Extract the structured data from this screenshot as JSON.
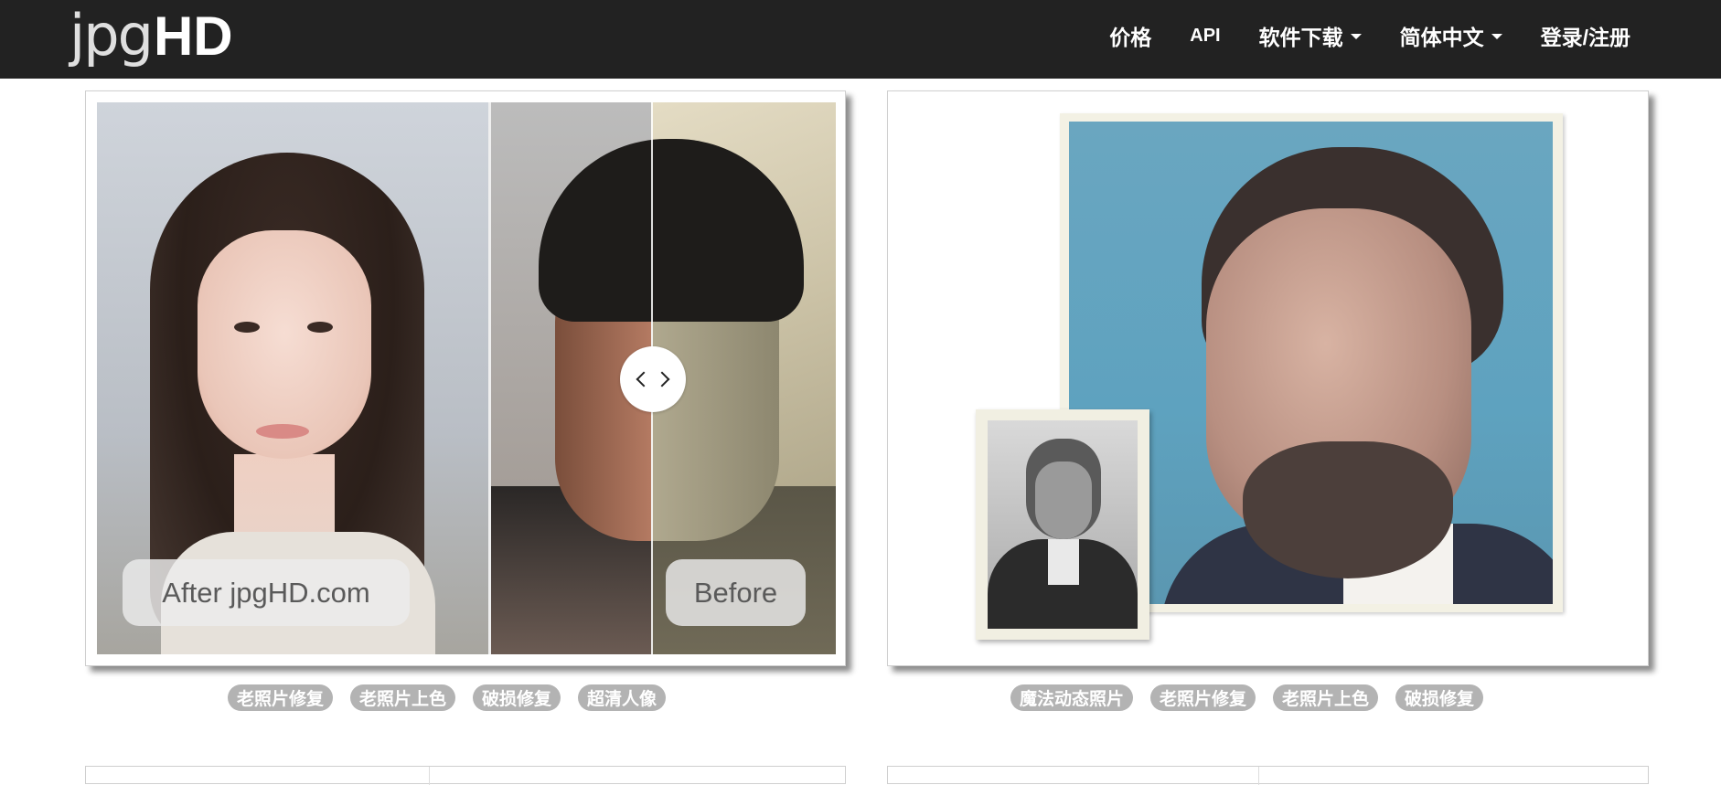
{
  "header": {
    "logo_light": "jpg",
    "logo_bold": "HD",
    "nav": [
      {
        "label": "价格",
        "dropdown": false
      },
      {
        "label": "API",
        "dropdown": false
      },
      {
        "label": "软件下载",
        "dropdown": true
      },
      {
        "label": "简体中文",
        "dropdown": true
      },
      {
        "label": "登录/注册",
        "dropdown": false
      }
    ]
  },
  "cards": [
    {
      "compare": {
        "after_label": "After jpgHD.com",
        "before_label": "Before"
      },
      "tags": [
        "老照片修复",
        "老照片上色",
        "破损修复",
        "超清人像"
      ]
    },
    {
      "tags": [
        "魔法动态照片",
        "老照片修复",
        "老照片上色",
        "破损修复"
      ]
    }
  ],
  "colors": {
    "topbar": "#222222",
    "tag_bg": "#b3b3b3",
    "tag_text": "#ffffff"
  }
}
